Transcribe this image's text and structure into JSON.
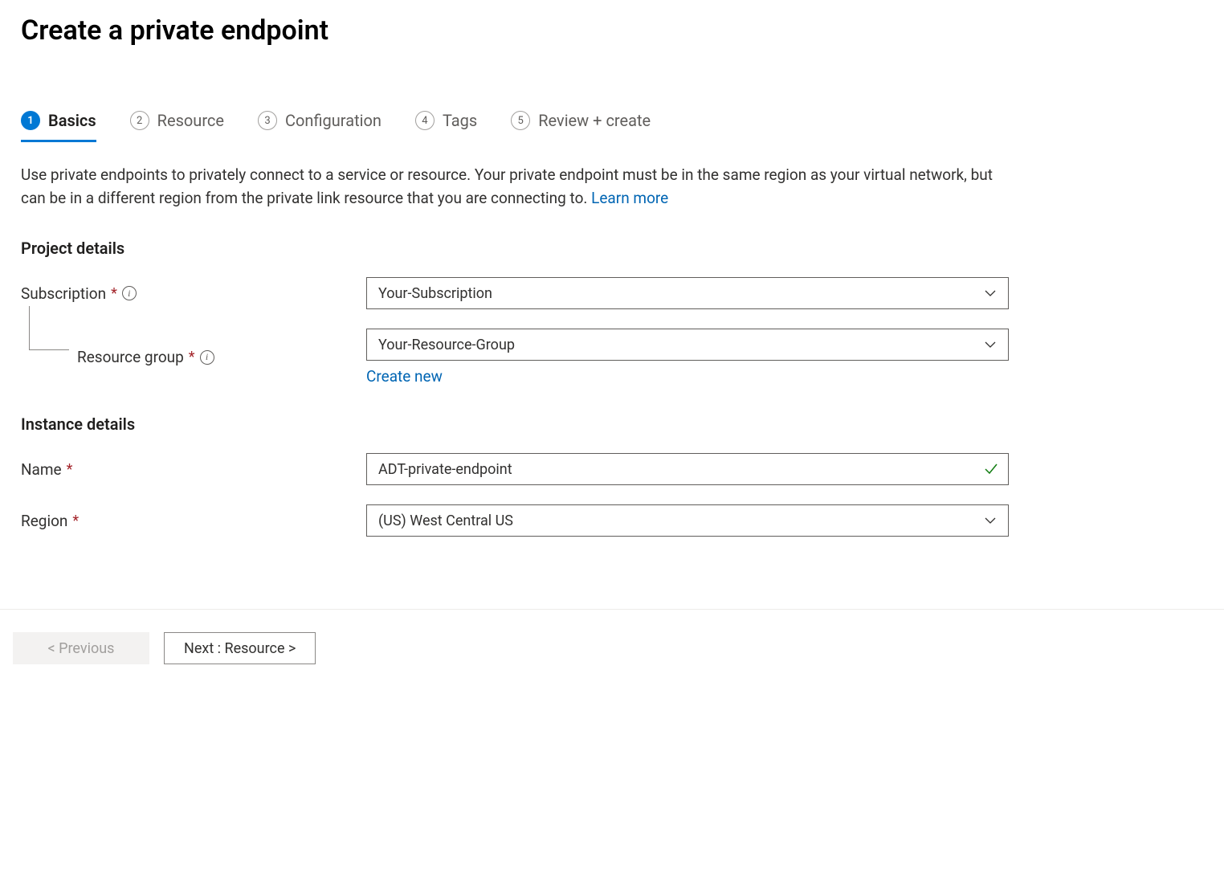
{
  "page_title": "Create a private endpoint",
  "tabs": [
    {
      "number": "1",
      "label": "Basics"
    },
    {
      "number": "2",
      "label": "Resource"
    },
    {
      "number": "3",
      "label": "Configuration"
    },
    {
      "number": "4",
      "label": "Tags"
    },
    {
      "number": "5",
      "label": "Review + create"
    }
  ],
  "description_text": "Use private endpoints to privately connect to a service or resource. Your private endpoint must be in the same region as your virtual network, but can be in a different region from the private link resource that you are connecting to.  ",
  "learn_more_label": "Learn more",
  "sections": {
    "project_details": {
      "heading": "Project details",
      "subscription_label": "Subscription",
      "subscription_value": "Your-Subscription",
      "resource_group_label": "Resource group",
      "resource_group_value": "Your-Resource-Group",
      "create_new_label": "Create new"
    },
    "instance_details": {
      "heading": "Instance details",
      "name_label": "Name",
      "name_value": "ADT-private-endpoint",
      "region_label": "Region",
      "region_value": "(US) West Central US"
    }
  },
  "footer": {
    "previous_label": "< Previous",
    "next_label": "Next : Resource >"
  }
}
